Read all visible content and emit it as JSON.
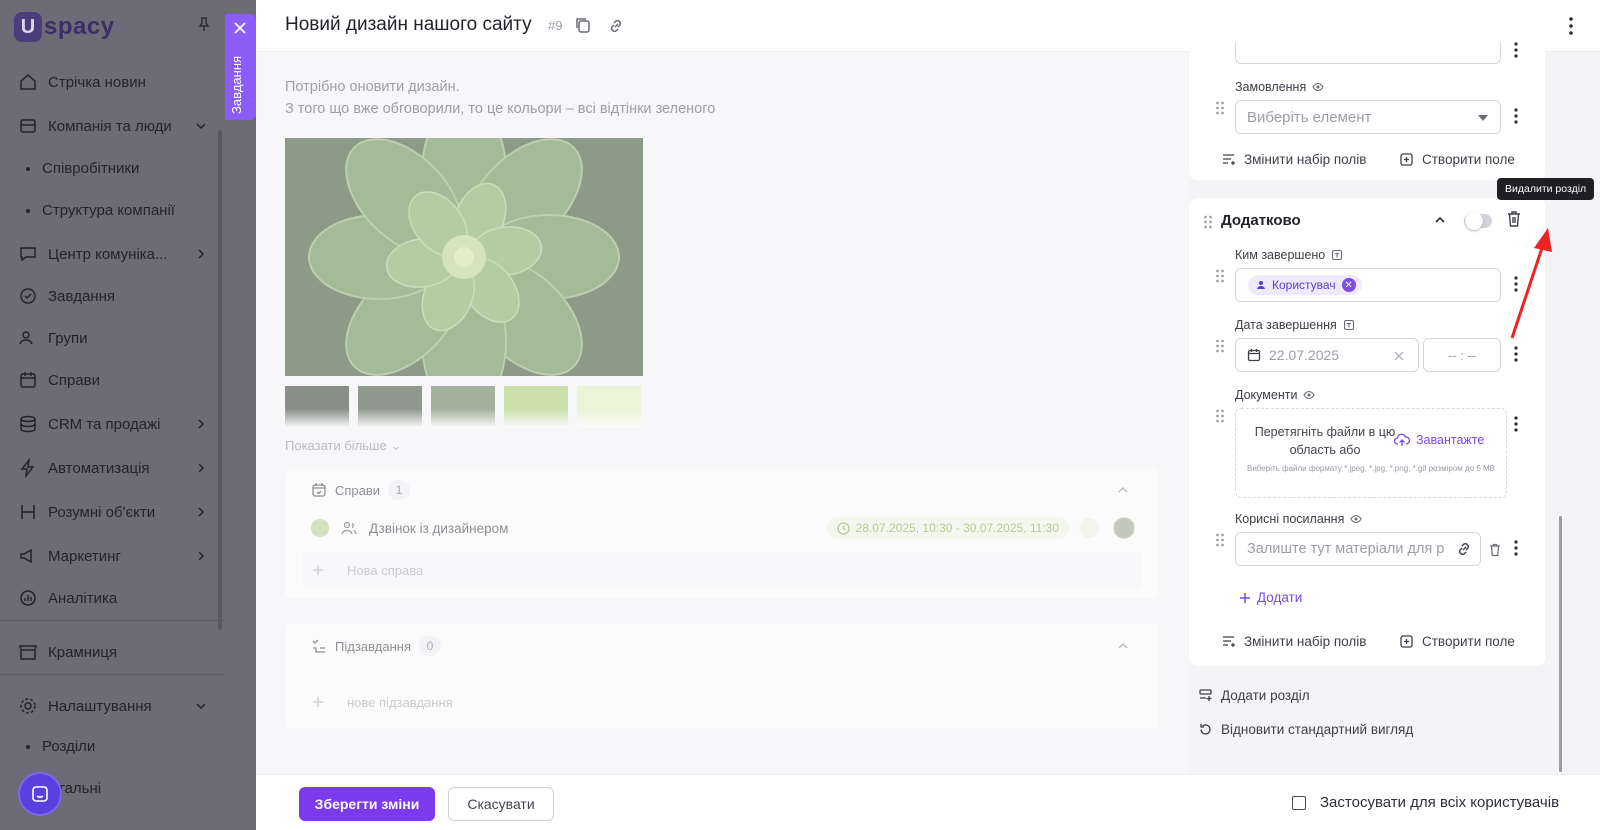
{
  "sidebar": {
    "logo_text": "spacy",
    "items": [
      {
        "label": "Стрічка новин",
        "icon": "home-icon"
      },
      {
        "label": "Компанія та люди",
        "icon": "company-icon",
        "expanded": true,
        "children": [
          "Співробітники",
          "Структура компанії"
        ]
      },
      {
        "label": "Центр комуніка...",
        "icon": "chat-center-icon"
      },
      {
        "label": "Завдання",
        "icon": "task-check-icon"
      },
      {
        "label": "Групи",
        "icon": "groups-icon"
      },
      {
        "label": "Справи",
        "icon": "calendar-icon"
      },
      {
        "label": "CRM та продажі",
        "icon": "crm-icon"
      },
      {
        "label": "Автоматизація",
        "icon": "lightning-icon"
      },
      {
        "label": "Розумні об'єкти",
        "icon": "smart-objects-icon"
      },
      {
        "label": "Маркетинг",
        "icon": "megaphone-icon"
      },
      {
        "label": "Аналітика",
        "icon": "analytics-icon"
      },
      {
        "label": "Крамниця",
        "icon": "store-icon"
      },
      {
        "label": "Налаштування",
        "icon": "settings-gear-icon",
        "expanded": true,
        "children": [
          "Розділи",
          "Загальні"
        ]
      }
    ]
  },
  "tasks_tab": {
    "label": "Завдання"
  },
  "header": {
    "title": "Новий дизайн нашого сайту",
    "task_number": "#9"
  },
  "content": {
    "description": [
      "Потрібно оновити дизайн.",
      "З того що вже обговорили, то це кольори – всі відтінки зеленого"
    ],
    "swatch_colors": [
      "#2f3a2c",
      "#3d4b38",
      "#5e7a52",
      "#a8cd6a",
      "#e3f2bd"
    ],
    "show_more": "Показати більше",
    "activities": {
      "title": "Справи",
      "count": "1",
      "items": [
        {
          "title": "Дзвінок із дизайнером",
          "when": "28.07.2025, 10:30 - 30.07.2025, 11:30"
        }
      ],
      "new_placeholder": "Нова справа"
    },
    "subtasks": {
      "title": "Підзавдання",
      "count": "0",
      "new_placeholder": "нове підзавдання"
    }
  },
  "settings": {
    "prev_select_value": "Виберіть елемент",
    "order_field": {
      "label": "Замовлення",
      "placeholder": "Виберіть елемент"
    },
    "change_fields": "Змінити набір полів",
    "create_field": "Створити поле",
    "tooltip": "Видалити розділ",
    "section": {
      "title": "Додатково",
      "completed_by": {
        "label": "Ким завершено",
        "chip": "Користувач"
      },
      "completed_date": {
        "label": "Дата завершення",
        "date": "22.07.2025",
        "time": "-- : --"
      },
      "documents": {
        "label": "Документи",
        "drop_text": "Перетягніть файли в цю область або",
        "upload": "Завантажте",
        "hint": "Виберіть файли формату *.jpeg, *.jpg, *.png, *.gif розміром до 5 MB"
      },
      "links": {
        "label": "Корисні посилання",
        "placeholder": "Залиште тут матеріали для р",
        "add": "Додати"
      }
    },
    "add_section": "Додати розділ",
    "restore_default": "Відновити стандартний вигляд"
  },
  "footer": {
    "save": "Зберегти зміни",
    "cancel": "Скасувати",
    "apply_all": "Застосувати для всіх користувачів"
  },
  "colors": {
    "accent": "#7c3aed",
    "sidebar_dim": "#6e6b78"
  }
}
